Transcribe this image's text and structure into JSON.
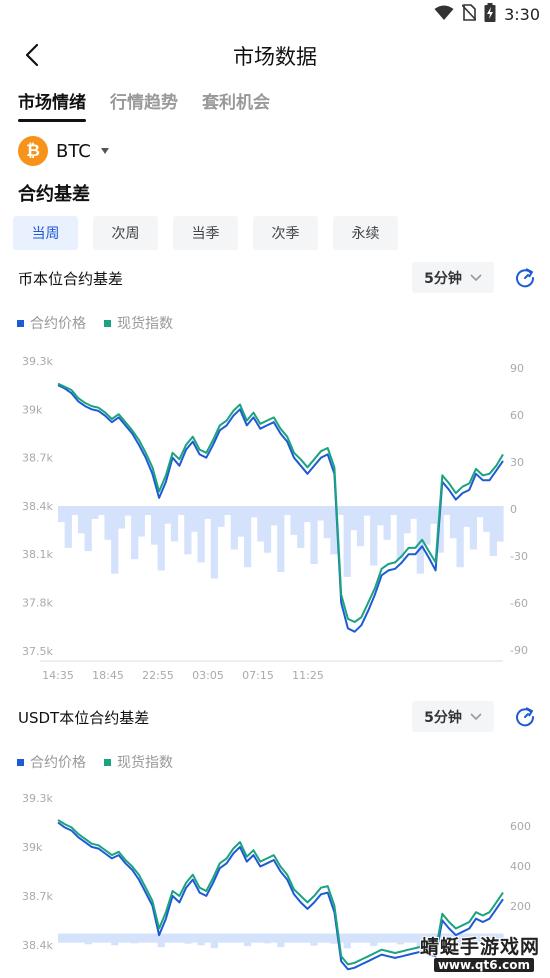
{
  "status_bar": {
    "time": "3:30",
    "icons": [
      "wifi-icon",
      "no-sim-icon",
      "battery-charging-icon"
    ]
  },
  "header": {
    "title": "市场数据",
    "back_icon": "chevron-left-icon"
  },
  "tabs": [
    {
      "label": "市场情绪",
      "active": true
    },
    {
      "label": "行情趋势",
      "active": false
    },
    {
      "label": "套利机会",
      "active": false
    }
  ],
  "coin": {
    "symbol": "₿",
    "name": "BTC",
    "icon_color": "#f7931a"
  },
  "section_title": "合约基差",
  "periods": [
    {
      "label": "当周",
      "active": true
    },
    {
      "label": "次周",
      "active": false
    },
    {
      "label": "当季",
      "active": false
    },
    {
      "label": "次季",
      "active": false
    },
    {
      "label": "永续",
      "active": false
    }
  ],
  "colors": {
    "contract": "#1f5ad6",
    "spot": "#1aa37f",
    "basis_fill": "#d5e2fb",
    "accent": "#1f5ad6"
  },
  "watermark": {
    "name": "蜻蜓手游戏网",
    "url": "www.qt6.com"
  },
  "chart_data": [
    {
      "type": "line",
      "title": "币本位合约基差",
      "interval": "5分钟",
      "legend": [
        "合约价格",
        "现货指数"
      ],
      "x_ticks": [
        "14:35",
        "18:45",
        "22:55",
        "03:05",
        "07:15",
        "11:25"
      ],
      "y_left_ticks": [
        "39.3k",
        "39k",
        "38.7k",
        "38.4k",
        "38.1k",
        "37.8k",
        "37.5k"
      ],
      "y_right_ticks": [
        "90",
        "60",
        "30",
        "0",
        "-30",
        "-60",
        "-90"
      ],
      "ylim_left": [
        37500,
        39300
      ],
      "ylim_right": [
        -90,
        90
      ],
      "series": [
        {
          "name": "合约价格",
          "axis": "left",
          "values": [
            39150,
            39130,
            39100,
            39050,
            39020,
            39000,
            38990,
            38960,
            38920,
            38950,
            38900,
            38850,
            38780,
            38700,
            38600,
            38450,
            38550,
            38700,
            38650,
            38750,
            38800,
            38720,
            38700,
            38780,
            38870,
            38900,
            38960,
            39000,
            38900,
            38950,
            38880,
            38900,
            38920,
            38850,
            38800,
            38700,
            38650,
            38600,
            38650,
            38700,
            38720,
            38600,
            37800,
            37640,
            37620,
            37660,
            37750,
            37850,
            37970,
            38000,
            38010,
            38050,
            38100,
            38100,
            38150,
            38080,
            38000,
            38550,
            38500,
            38440,
            38480,
            38500,
            38600,
            38560,
            38560,
            38620,
            38680
          ]
        },
        {
          "name": "现货指数",
          "axis": "left",
          "values": [
            39160,
            39140,
            39120,
            39070,
            39040,
            39020,
            39010,
            38980,
            38940,
            38970,
            38920,
            38870,
            38810,
            38730,
            38640,
            38490,
            38590,
            38730,
            38690,
            38780,
            38830,
            38750,
            38730,
            38810,
            38900,
            38930,
            38990,
            39030,
            38930,
            38980,
            38910,
            38930,
            38950,
            38880,
            38830,
            38730,
            38690,
            38640,
            38690,
            38740,
            38760,
            38640,
            37850,
            37700,
            37680,
            37710,
            37800,
            37890,
            38010,
            38040,
            38050,
            38090,
            38140,
            38140,
            38190,
            38120,
            38050,
            38590,
            38540,
            38480,
            38520,
            38540,
            38630,
            38590,
            38600,
            38650,
            38720
          ]
        },
        {
          "name": "基差",
          "axis": "right",
          "type": "area",
          "values": [
            -10,
            -26,
            -4,
            -17,
            -28,
            -8,
            -3,
            -21,
            -42,
            -14,
            -6,
            -33,
            -19,
            -2,
            -24,
            -40,
            -11,
            -22,
            -5,
            -30,
            -16,
            -35,
            -8,
            -45,
            -13,
            -3,
            -27,
            -19,
            -38,
            -7,
            -22,
            -29,
            -12,
            -41,
            -4,
            -18,
            -26,
            -10,
            -36,
            -9,
            -20,
            -30,
            -1,
            -44,
            -15,
            -25,
            -6,
            -37,
            -12,
            -21,
            -3,
            -33,
            -17,
            -8,
            -42,
            -24,
            -11,
            -29,
            -5,
            -20,
            -38,
            -13,
            -27,
            -7,
            -16,
            -31,
            -22
          ]
        }
      ]
    },
    {
      "type": "line",
      "title": "USDT本位合约基差",
      "interval": "5分钟",
      "legend": [
        "合约价格",
        "现货指数"
      ],
      "y_left_ticks": [
        "39.3k",
        "39k",
        "38.7k",
        "38.4k"
      ],
      "y_right_ticks": [
        "600",
        "400",
        "200"
      ],
      "ylim_left": [
        38350,
        39300
      ],
      "ylim_right": [
        -100,
        700
      ],
      "series": [
        {
          "name": "合约价格",
          "axis": "left",
          "values": [
            39150,
            39120,
            39100,
            39060,
            39030,
            39000,
            38990,
            38960,
            38930,
            38950,
            38900,
            38860,
            38800,
            38720,
            38640,
            38460,
            38560,
            38700,
            38660,
            38750,
            38800,
            38720,
            38700,
            38780,
            38870,
            38900,
            38960,
            39000,
            38910,
            38950,
            38880,
            38900,
            38920,
            38850,
            38800,
            38710,
            38660,
            38620,
            38660,
            38710,
            38720,
            38600,
            38300,
            38250,
            38260,
            38280,
            38300,
            38320,
            38340,
            38330,
            38320,
            38330,
            38340,
            38350,
            38360,
            38340,
            38330,
            38550,
            38500,
            38460,
            38480,
            38500,
            38560,
            38540,
            38560,
            38620,
            38680
          ]
        },
        {
          "name": "现货指数",
          "axis": "left",
          "values": [
            39165,
            39140,
            39120,
            39080,
            39050,
            39020,
            39010,
            38980,
            38950,
            38970,
            38920,
            38880,
            38830,
            38750,
            38670,
            38500,
            38600,
            38730,
            38700,
            38780,
            38830,
            38750,
            38730,
            38810,
            38900,
            38930,
            38990,
            39030,
            38940,
            38980,
            38910,
            38930,
            38950,
            38880,
            38830,
            38740,
            38700,
            38660,
            38700,
            38750,
            38760,
            38640,
            38330,
            38280,
            38290,
            38310,
            38330,
            38350,
            38370,
            38360,
            38350,
            38360,
            38370,
            38380,
            38390,
            38370,
            38360,
            38590,
            38540,
            38500,
            38520,
            38540,
            38600,
            38580,
            38600,
            38660,
            38720
          ]
        },
        {
          "name": "基差",
          "axis": "right",
          "type": "area",
          "values": [
            -20,
            -45,
            -10,
            -30,
            -55,
            -15,
            -5,
            -40,
            -60,
            -25,
            -12,
            -50,
            -35,
            -8,
            -44,
            -70,
            -20,
            -38,
            -10,
            -52,
            -28,
            -60,
            -14,
            -75,
            -24,
            -6,
            -46,
            -33,
            -64,
            -12,
            -38,
            -50,
            -20,
            -70,
            -8,
            -30,
            -45,
            -18,
            -62,
            -16,
            -34,
            -52,
            -2,
            -76,
            -26,
            -44,
            -10,
            -64,
            -22,
            -36,
            -6,
            -56,
            -30,
            -14,
            -72,
            -42,
            -20,
            -50,
            -9,
            -34,
            -66,
            -23,
            -47,
            -12,
            -28,
            -54,
            -38
          ]
        }
      ]
    }
  ]
}
